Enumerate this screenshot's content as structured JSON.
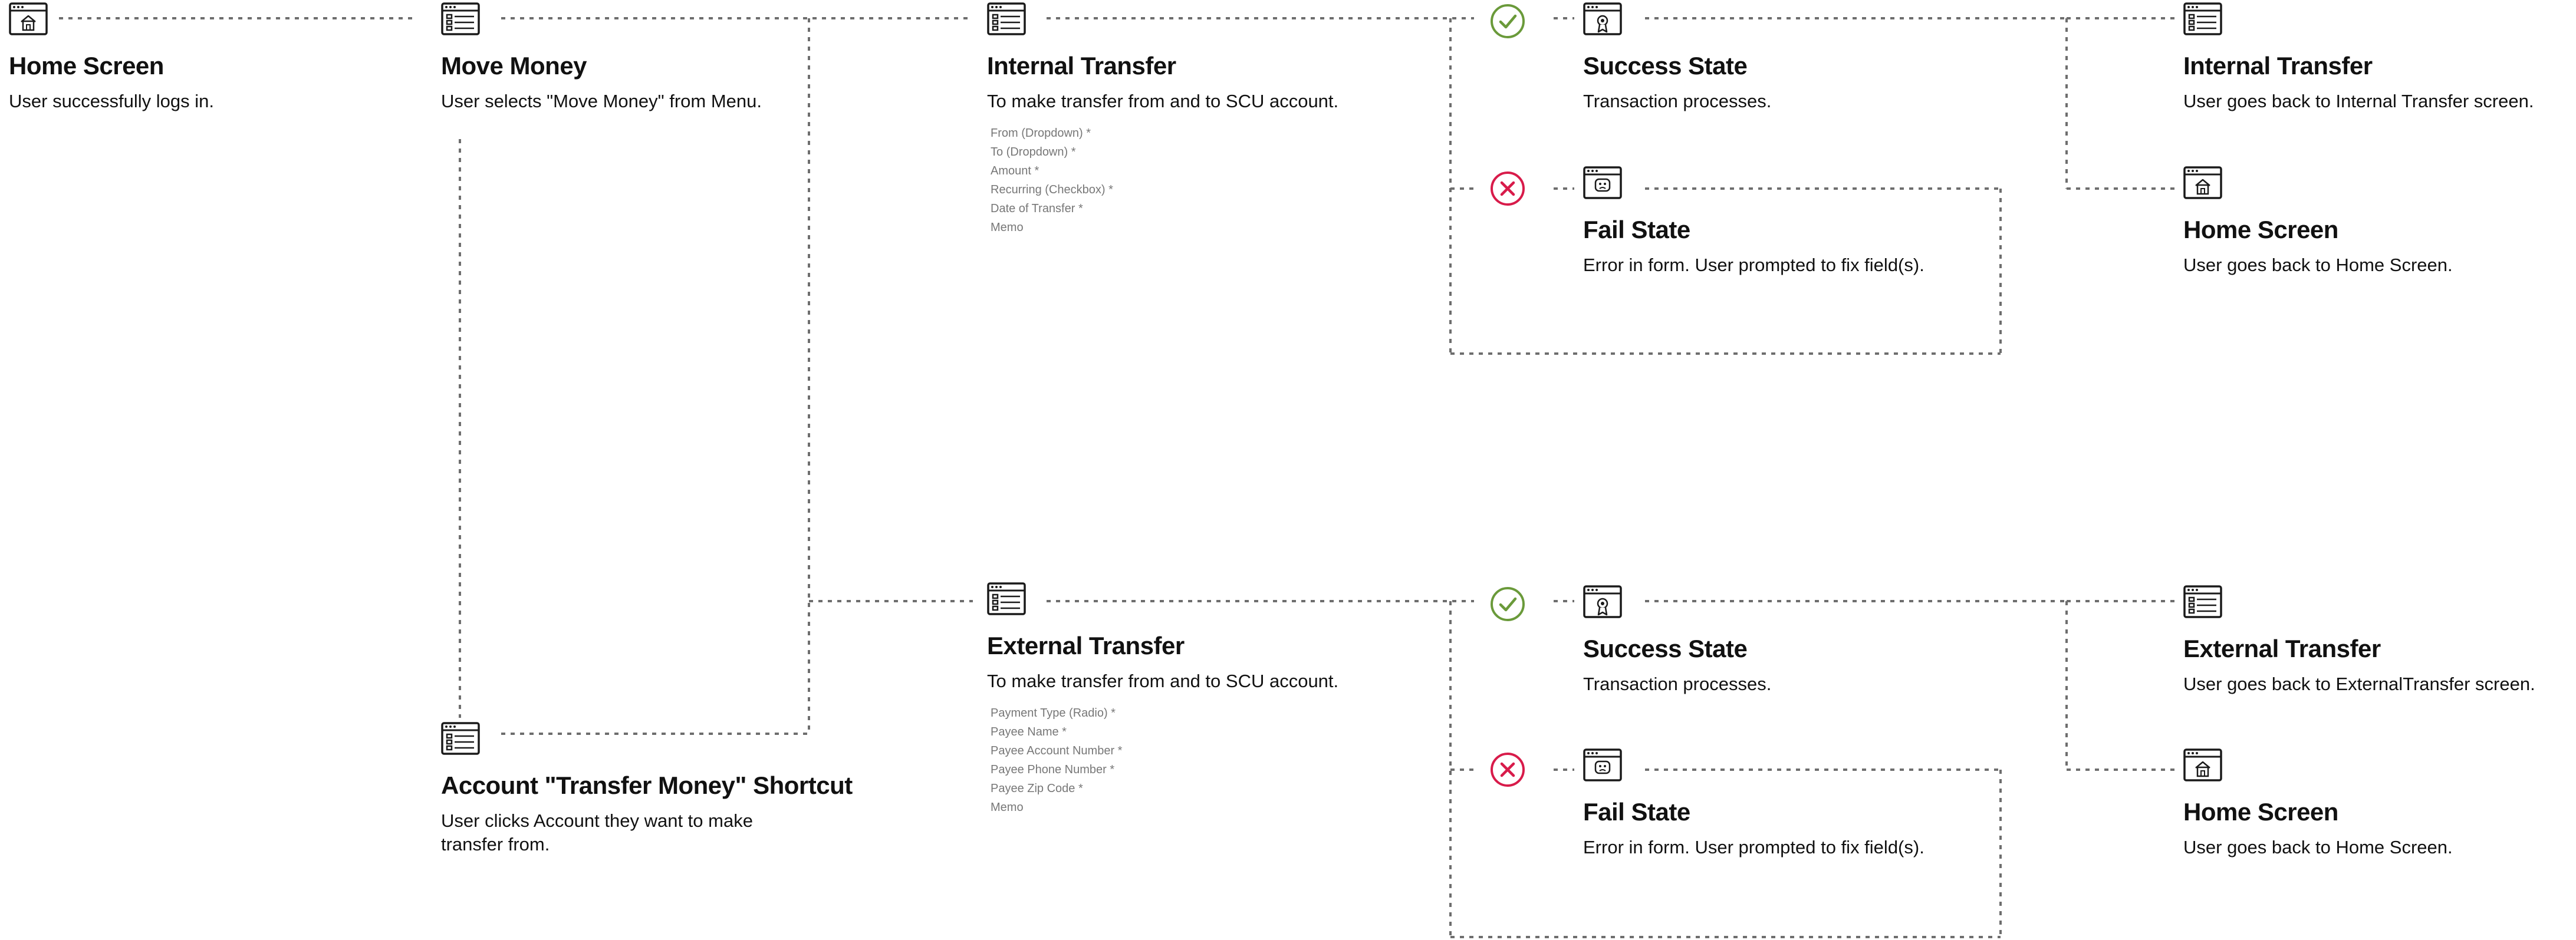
{
  "nodes": {
    "home": {
      "title": "Home Screen",
      "description": "User successfully logs in.",
      "icon": "home-window-icon"
    },
    "move_money": {
      "title": "Move Money",
      "description": "User selects \"Move Money\" from Menu.",
      "icon": "form-window-icon"
    },
    "shortcut": {
      "title": "Account \"Transfer Money\" Shortcut",
      "description": "User clicks Account they want to make transfer from.",
      "icon": "form-window-icon"
    },
    "internal_transfer": {
      "title": "Internal Transfer",
      "description": "To make transfer from and to SCU account.",
      "icon": "form-window-icon",
      "fields": [
        "From (Dropdown) *",
        "To (Dropdown) *",
        "Amount *",
        "Recurring (Checkbox) *",
        "Date of Transfer *",
        "Memo"
      ]
    },
    "external_transfer": {
      "title": "External Transfer",
      "description": "To make transfer from and to SCU account.",
      "icon": "form-window-icon",
      "fields": [
        "Payment Type (Radio) *",
        "Payee Name *",
        "Payee Account Number *",
        "Payee Phone Number *",
        "Payee Zip Code *",
        "Memo"
      ]
    },
    "success_internal": {
      "title": "Success State",
      "description": "Transaction processes.",
      "icon": "award-window-icon"
    },
    "fail_internal": {
      "title": "Fail State",
      "description": "Error in form. User prompted to fix field(s).",
      "icon": "error-window-icon"
    },
    "success_external": {
      "title": "Success State",
      "description": "Transaction processes.",
      "icon": "award-window-icon"
    },
    "fail_external": {
      "title": "Fail State",
      "description": "Error in form. User prompted to fix field(s).",
      "icon": "error-window-icon"
    },
    "back_internal": {
      "title": "Internal Transfer",
      "description": "User goes back to Internal Transfer screen.",
      "icon": "form-window-icon"
    },
    "home_after_internal": {
      "title": "Home Screen",
      "description": "User goes back to Home Screen.",
      "icon": "home-window-icon"
    },
    "back_external": {
      "title": "External Transfer",
      "description": "User goes back to ExternalTransfer screen.",
      "icon": "form-window-icon"
    },
    "home_after_external": {
      "title": "Home Screen",
      "description": "User goes back to Home Screen.",
      "icon": "home-window-icon"
    }
  },
  "status_icons": {
    "success": "check-circle-icon",
    "fail": "x-circle-icon"
  },
  "colors": {
    "line": "#6e6e6e",
    "icon": "#1a1a1a",
    "success": "#6a9a3a",
    "fail": "#d81b4a",
    "field_text": "#777777"
  }
}
